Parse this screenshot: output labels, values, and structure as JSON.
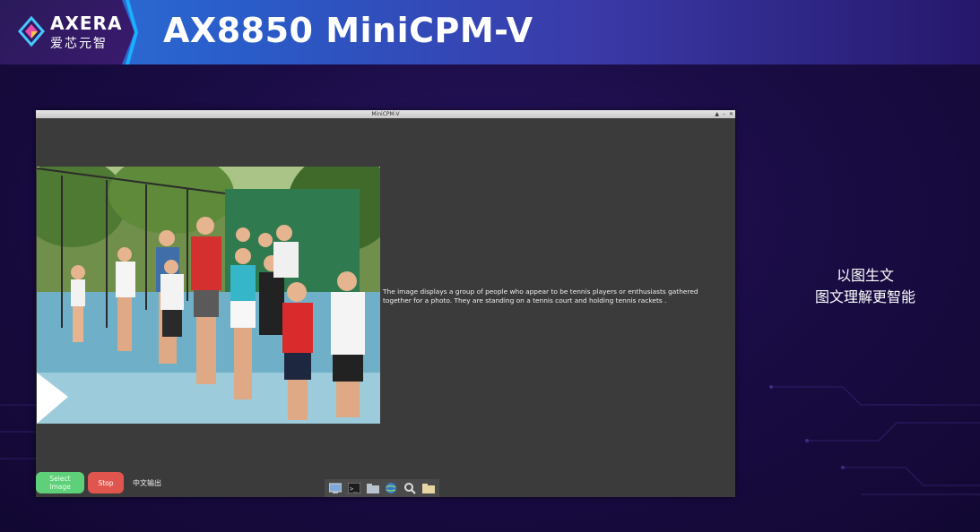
{
  "header": {
    "logo_en": "AXERA",
    "logo_cn": "爱芯元智",
    "title": "AX8850 MiniCPM-V"
  },
  "window": {
    "title": "MiniCPM-V",
    "controls": [
      "▲",
      "–",
      "✕"
    ],
    "caption": "The image displays a group of people who appear to be tennis players or enthusiasts gathered together for a photo. They are standing on a tennis court and holding tennis rackets .",
    "buttons": {
      "select_image": "Select Image",
      "stop": "Stop"
    },
    "cn_output_label": "中文输出",
    "taskbar_icons": [
      "desktop-icon",
      "terminal-icon",
      "folder-icon",
      "globe-icon",
      "search-icon",
      "files-icon"
    ]
  },
  "side": {
    "line1": "以图生文",
    "line2": "图文理解更智能"
  },
  "colors": {
    "select_button": "#5fd07a",
    "stop_button": "#e0564e",
    "accent": "#1ab0ff"
  }
}
